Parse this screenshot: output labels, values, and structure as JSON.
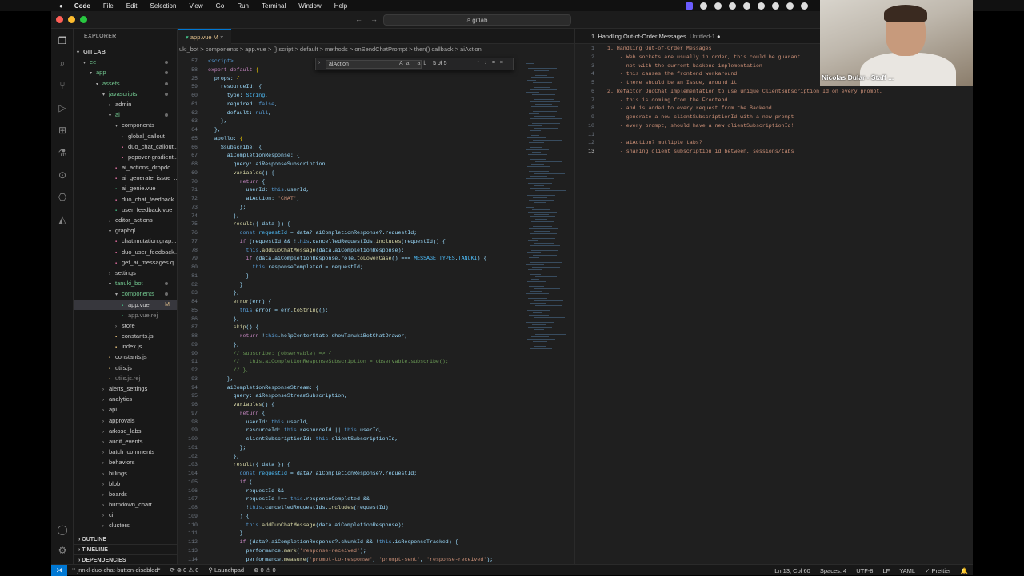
{
  "menubar": {
    "app": "Code",
    "items": [
      "File",
      "Edit",
      "Selection",
      "View",
      "Go",
      "Run",
      "Terminal",
      "Window",
      "Help"
    ]
  },
  "window": {
    "search": "gitlab"
  },
  "camera": {
    "name": "Nicolas Dular - Staff ..."
  },
  "sidebar": {
    "header": "EXPLORER",
    "root": "GITLAB",
    "tree": [
      {
        "label": "ee",
        "depth": 0,
        "type": "folder",
        "open": true,
        "git": "dot"
      },
      {
        "label": "app",
        "depth": 1,
        "type": "folder",
        "open": true,
        "git": "dot"
      },
      {
        "label": "assets",
        "depth": 2,
        "type": "folder",
        "open": true,
        "git": "dot"
      },
      {
        "label": "javascripts",
        "depth": 3,
        "type": "folder",
        "open": true,
        "git": "dot"
      },
      {
        "label": "admin",
        "depth": 4,
        "type": "folder",
        "open": false
      },
      {
        "label": "ai",
        "depth": 4,
        "type": "folder",
        "open": true,
        "git": "dot"
      },
      {
        "label": "components",
        "depth": 5,
        "type": "folder",
        "open": true
      },
      {
        "label": "global_callout",
        "depth": 6,
        "type": "folder",
        "open": false
      },
      {
        "label": "duo_chat_callout...",
        "depth": 6,
        "type": "file"
      },
      {
        "label": "popover-gradient...",
        "depth": 6,
        "type": "file"
      },
      {
        "label": "ai_actions_dropdo...",
        "depth": 5,
        "type": "file"
      },
      {
        "label": "ai_generate_issue_...",
        "depth": 5,
        "type": "file"
      },
      {
        "label": "ai_genie.vue",
        "depth": 5,
        "type": "file"
      },
      {
        "label": "duo_chat_feedback...",
        "depth": 5,
        "type": "file"
      },
      {
        "label": "user_feedback.vue",
        "depth": 5,
        "type": "file"
      },
      {
        "label": "editor_actions",
        "depth": 4,
        "type": "folder",
        "open": false
      },
      {
        "label": "graphql",
        "depth": 4,
        "type": "folder",
        "open": true
      },
      {
        "label": "chat.mutation.grap...",
        "depth": 5,
        "type": "file"
      },
      {
        "label": "duo_user_feedback...",
        "depth": 5,
        "type": "file"
      },
      {
        "label": "get_ai_messages.q...",
        "depth": 5,
        "type": "file"
      },
      {
        "label": "settings",
        "depth": 4,
        "type": "folder",
        "open": false
      },
      {
        "label": "tanuki_bot",
        "depth": 4,
        "type": "folder",
        "open": true,
        "git": "dot"
      },
      {
        "label": "components",
        "depth": 5,
        "type": "folder",
        "open": true,
        "git": "dot"
      },
      {
        "label": "app.vue",
        "depth": 6,
        "type": "file",
        "status": "M",
        "selected": true
      },
      {
        "label": "app.vue.rej",
        "depth": 6,
        "type": "file",
        "dim": true
      },
      {
        "label": "store",
        "depth": 5,
        "type": "folder",
        "open": false
      },
      {
        "label": "constants.js",
        "depth": 5,
        "type": "file"
      },
      {
        "label": "index.js",
        "depth": 5,
        "type": "file"
      },
      {
        "label": "constants.js",
        "depth": 4,
        "type": "file"
      },
      {
        "label": "utils.js",
        "depth": 4,
        "type": "file"
      },
      {
        "label": "utils.js.rej",
        "depth": 4,
        "type": "file",
        "dim": true
      },
      {
        "label": "alerts_settings",
        "depth": 3,
        "type": "folder",
        "open": false
      },
      {
        "label": "analytics",
        "depth": 3,
        "type": "folder",
        "open": false
      },
      {
        "label": "api",
        "depth": 3,
        "type": "folder",
        "open": false
      },
      {
        "label": "approvals",
        "depth": 3,
        "type": "folder",
        "open": false
      },
      {
        "label": "arkose_labs",
        "depth": 3,
        "type": "folder",
        "open": false
      },
      {
        "label": "audit_events",
        "depth": 3,
        "type": "folder",
        "open": false
      },
      {
        "label": "batch_comments",
        "depth": 3,
        "type": "folder",
        "open": false
      },
      {
        "label": "behaviors",
        "depth": 3,
        "type": "folder",
        "open": false
      },
      {
        "label": "billings",
        "depth": 3,
        "type": "folder",
        "open": false
      },
      {
        "label": "blob",
        "depth": 3,
        "type": "folder",
        "open": false
      },
      {
        "label": "boards",
        "depth": 3,
        "type": "folder",
        "open": false
      },
      {
        "label": "burndown_chart",
        "depth": 3,
        "type": "folder",
        "open": false
      },
      {
        "label": "ci",
        "depth": 3,
        "type": "folder",
        "open": false
      },
      {
        "label": "clusters",
        "depth": 3,
        "type": "folder",
        "open": false
      }
    ],
    "sections": [
      "OUTLINE",
      "TIMELINE",
      "DEPENDENCIES"
    ]
  },
  "editor": {
    "tab": "app.vue M",
    "breadcrumb": "uki_bot > components > app.vue > {} script > default > methods > onSendChatPrompt > then() callback > aiAction",
    "find": {
      "value": "aiAction",
      "options": "Aa ab .*",
      "count": "5 of 5"
    },
    "lines": [
      {
        "n": "57",
        "h": "<span class='bl'>&lt;script&gt;</span>"
      },
      {
        "n": "58",
        "h": "<span class='k'>export default</span> <span class='p'>{</span>"
      },
      {
        "n": "25",
        "h": "  props: <span class='p'>{</span>"
      },
      {
        "n": "59",
        "h": "    resourceId: {"
      },
      {
        "n": "60",
        "h": "      type: <span class='v'>String</span>,"
      },
      {
        "n": "61",
        "h": "      required: <span class='bl'>false</span>,"
      },
      {
        "n": "62",
        "h": "      default: <span class='bl'>null</span>,"
      },
      {
        "n": "63",
        "h": "    },"
      },
      {
        "n": "64",
        "h": "  },"
      },
      {
        "n": "65",
        "h": "  apollo: <span class='p'>{</span>"
      },
      {
        "n": "66",
        "h": "    $subscribe: {"
      },
      {
        "n": "67",
        "h": "      aiCompletionResponse: {"
      },
      {
        "n": "68",
        "h": "        query: aiResponseSubscription,"
      },
      {
        "n": "69",
        "h": "        <span class='f'>variables</span>() {"
      },
      {
        "n": "70",
        "h": "          <span class='k'>return</span> {"
      },
      {
        "n": "71",
        "h": "            userId: <span class='bl'>this</span>.userId,"
      },
      {
        "n": "72",
        "h": "            aiAction: <span class='s'>'CHAT'</span>,"
      },
      {
        "n": "73",
        "h": "          };"
      },
      {
        "n": "74",
        "h": "        },"
      },
      {
        "n": "75",
        "h": "        <span class='f'>result</span>({ data }) {"
      },
      {
        "n": "76",
        "h": "          <span class='bl'>const</span> <span class='v'>requestId</span> = data?.aiCompletionResponse?.requestId;"
      },
      {
        "n": "77",
        "h": "          <span class='k'>if</span> (requestId &amp;&amp; !<span class='bl'>this</span>.cancelledRequestIds.<span class='f'>includes</span>(requestId)) {"
      },
      {
        "n": "78",
        "h": "            <span class='bl'>this</span>.<span class='f'>addDuoChatMessage</span>(data.aiCompletionResponse);"
      },
      {
        "n": "79",
        "h": "            <span class='k'>if</span> (data.aiCompletionResponse.role.<span class='f'>toLowerCase</span>() === <span class='v'>MESSAGE_TYPES</span>.<span class='v'>TANUKI</span>) {"
      },
      {
        "n": "80",
        "h": "              <span class='bl'>this</span>.responseCompleted = requestId;"
      },
      {
        "n": "81",
        "h": "            }"
      },
      {
        "n": "82",
        "h": "          }"
      },
      {
        "n": "83",
        "h": "        },"
      },
      {
        "n": "84",
        "h": "        <span class='f'>error</span>(err) {"
      },
      {
        "n": "85",
        "h": "          <span class='bl'>this</span>.error = err.<span class='f'>toString</span>();"
      },
      {
        "n": "86",
        "h": "        },"
      },
      {
        "n": "87",
        "h": "        <span class='f'>skip</span>() {"
      },
      {
        "n": "88",
        "h": "          <span class='k'>return</span> !<span class='bl'>this</span>.helpCenterState.showTanukiBotChatDrawer;"
      },
      {
        "n": "89",
        "h": "        },"
      },
      {
        "n": "90",
        "h": "        <span class='cm'>// subscribe: (observable) =&gt; {</span>"
      },
      {
        "n": "91",
        "h": "        <span class='cm'>//   this.aiCompletionResponseSubscription = observable.subscribe();</span>"
      },
      {
        "n": "92",
        "h": "        <span class='cm'>// },</span>"
      },
      {
        "n": "93",
        "h": "      },"
      },
      {
        "n": "94",
        "h": "      aiCompletionResponseStream: {"
      },
      {
        "n": "95",
        "h": "        query: aiResponseStreamSubscription,"
      },
      {
        "n": "96",
        "h": "        <span class='f'>variables</span>() {"
      },
      {
        "n": "97",
        "h": "          <span class='k'>return</span> {"
      },
      {
        "n": "98",
        "h": "            userId: <span class='bl'>this</span>.userId,"
      },
      {
        "n": "99",
        "h": "            resourceId: <span class='bl'>this</span>.resourceId || <span class='bl'>this</span>.userId,"
      },
      {
        "n": "100",
        "h": "            clientSubscriptionId: <span class='bl'>this</span>.clientSubscriptionId,"
      },
      {
        "n": "101",
        "h": "          };"
      },
      {
        "n": "102",
        "h": "        },"
      },
      {
        "n": "103",
        "h": "        <span class='f'>result</span>({ data }) {"
      },
      {
        "n": "104",
        "h": "          <span class='bl'>const</span> <span class='v'>requestId</span> = data?.aiCompletionResponse?.requestId;"
      },
      {
        "n": "105",
        "h": "          <span class='k'>if</span> ("
      },
      {
        "n": "106",
        "h": "            requestId &amp;&amp;"
      },
      {
        "n": "107",
        "h": "            requestId !== <span class='bl'>this</span>.responseCompleted &amp;&amp;"
      },
      {
        "n": "108",
        "h": "            !<span class='bl'>this</span>.cancelledRequestIds.<span class='f'>includes</span>(requestId)"
      },
      {
        "n": "109",
        "h": "          ) {"
      },
      {
        "n": "110",
        "h": "            <span class='bl'>this</span>.<span class='f'>addDuoChatMessage</span>(data.aiCompletionResponse);"
      },
      {
        "n": "111",
        "h": "          }"
      },
      {
        "n": "112",
        "h": "          <span class='k'>if</span> (data?.aiCompletionResponse?.chunkId &amp;&amp; !<span class='bl'>this</span>.isResponseTracked) {"
      },
      {
        "n": "113",
        "h": "            performance.<span class='f'>mark</span>(<span class='s'>'response-received'</span>);"
      },
      {
        "n": "114",
        "h": "            performance.<span class='f'>measure</span>(<span class='s'>'prompt-to-response'</span>, <span class='s'>'prompt-sent'</span>, <span class='s'>'response-received'</span>);"
      }
    ]
  },
  "notes": {
    "tab": "1. Handling Out-of-Order Messages",
    "tab_sub": "Untitled-1",
    "lines": [
      {
        "n": "1",
        "t": "1. Handling Out-of-Order Messages"
      },
      {
        "n": "2",
        "t": "    - Web sockets are usually in order, this could be guarant"
      },
      {
        "n": "3",
        "t": "    - not with the current backend implementation"
      },
      {
        "n": "4",
        "t": "    - this causes the frontend workaround"
      },
      {
        "n": "5",
        "t": "    - there should be an Issue, around it"
      },
      {
        "n": "6",
        "t": "2. Refactor DuoChat Implementation to use unique ClientSubscription Id on every prompt,"
      },
      {
        "n": "7",
        "t": "    - this is coming from the Frontend"
      },
      {
        "n": "8",
        "t": "    - and is added to every request from the Backend."
      },
      {
        "n": "9",
        "t": "    - generate a new clientSubscriptionId with a new prompt"
      },
      {
        "n": "10",
        "t": "    - every prompt, should have a new clientSubscriptionId!"
      },
      {
        "n": "11",
        "t": ""
      },
      {
        "n": "12",
        "t": "    - aiAction? mutliple tabs?"
      },
      {
        "n": "13",
        "t": "    - sharing client subscription id between, sessions/tabs"
      }
    ]
  },
  "status": {
    "branch": "jnnkl-duo-chat-button-disabled*",
    "sync": "⟳ ⊗ 0 ⚠ 0",
    "launch": "Launchpad",
    "errors": "⊗ 0 ⚠ 0",
    "cursor": "Ln 13, Col 60",
    "spaces": "Spaces: 4",
    "enc": "UTF-8",
    "eol": "LF",
    "lang": "YAML",
    "fmt": "✓ Prettier"
  }
}
